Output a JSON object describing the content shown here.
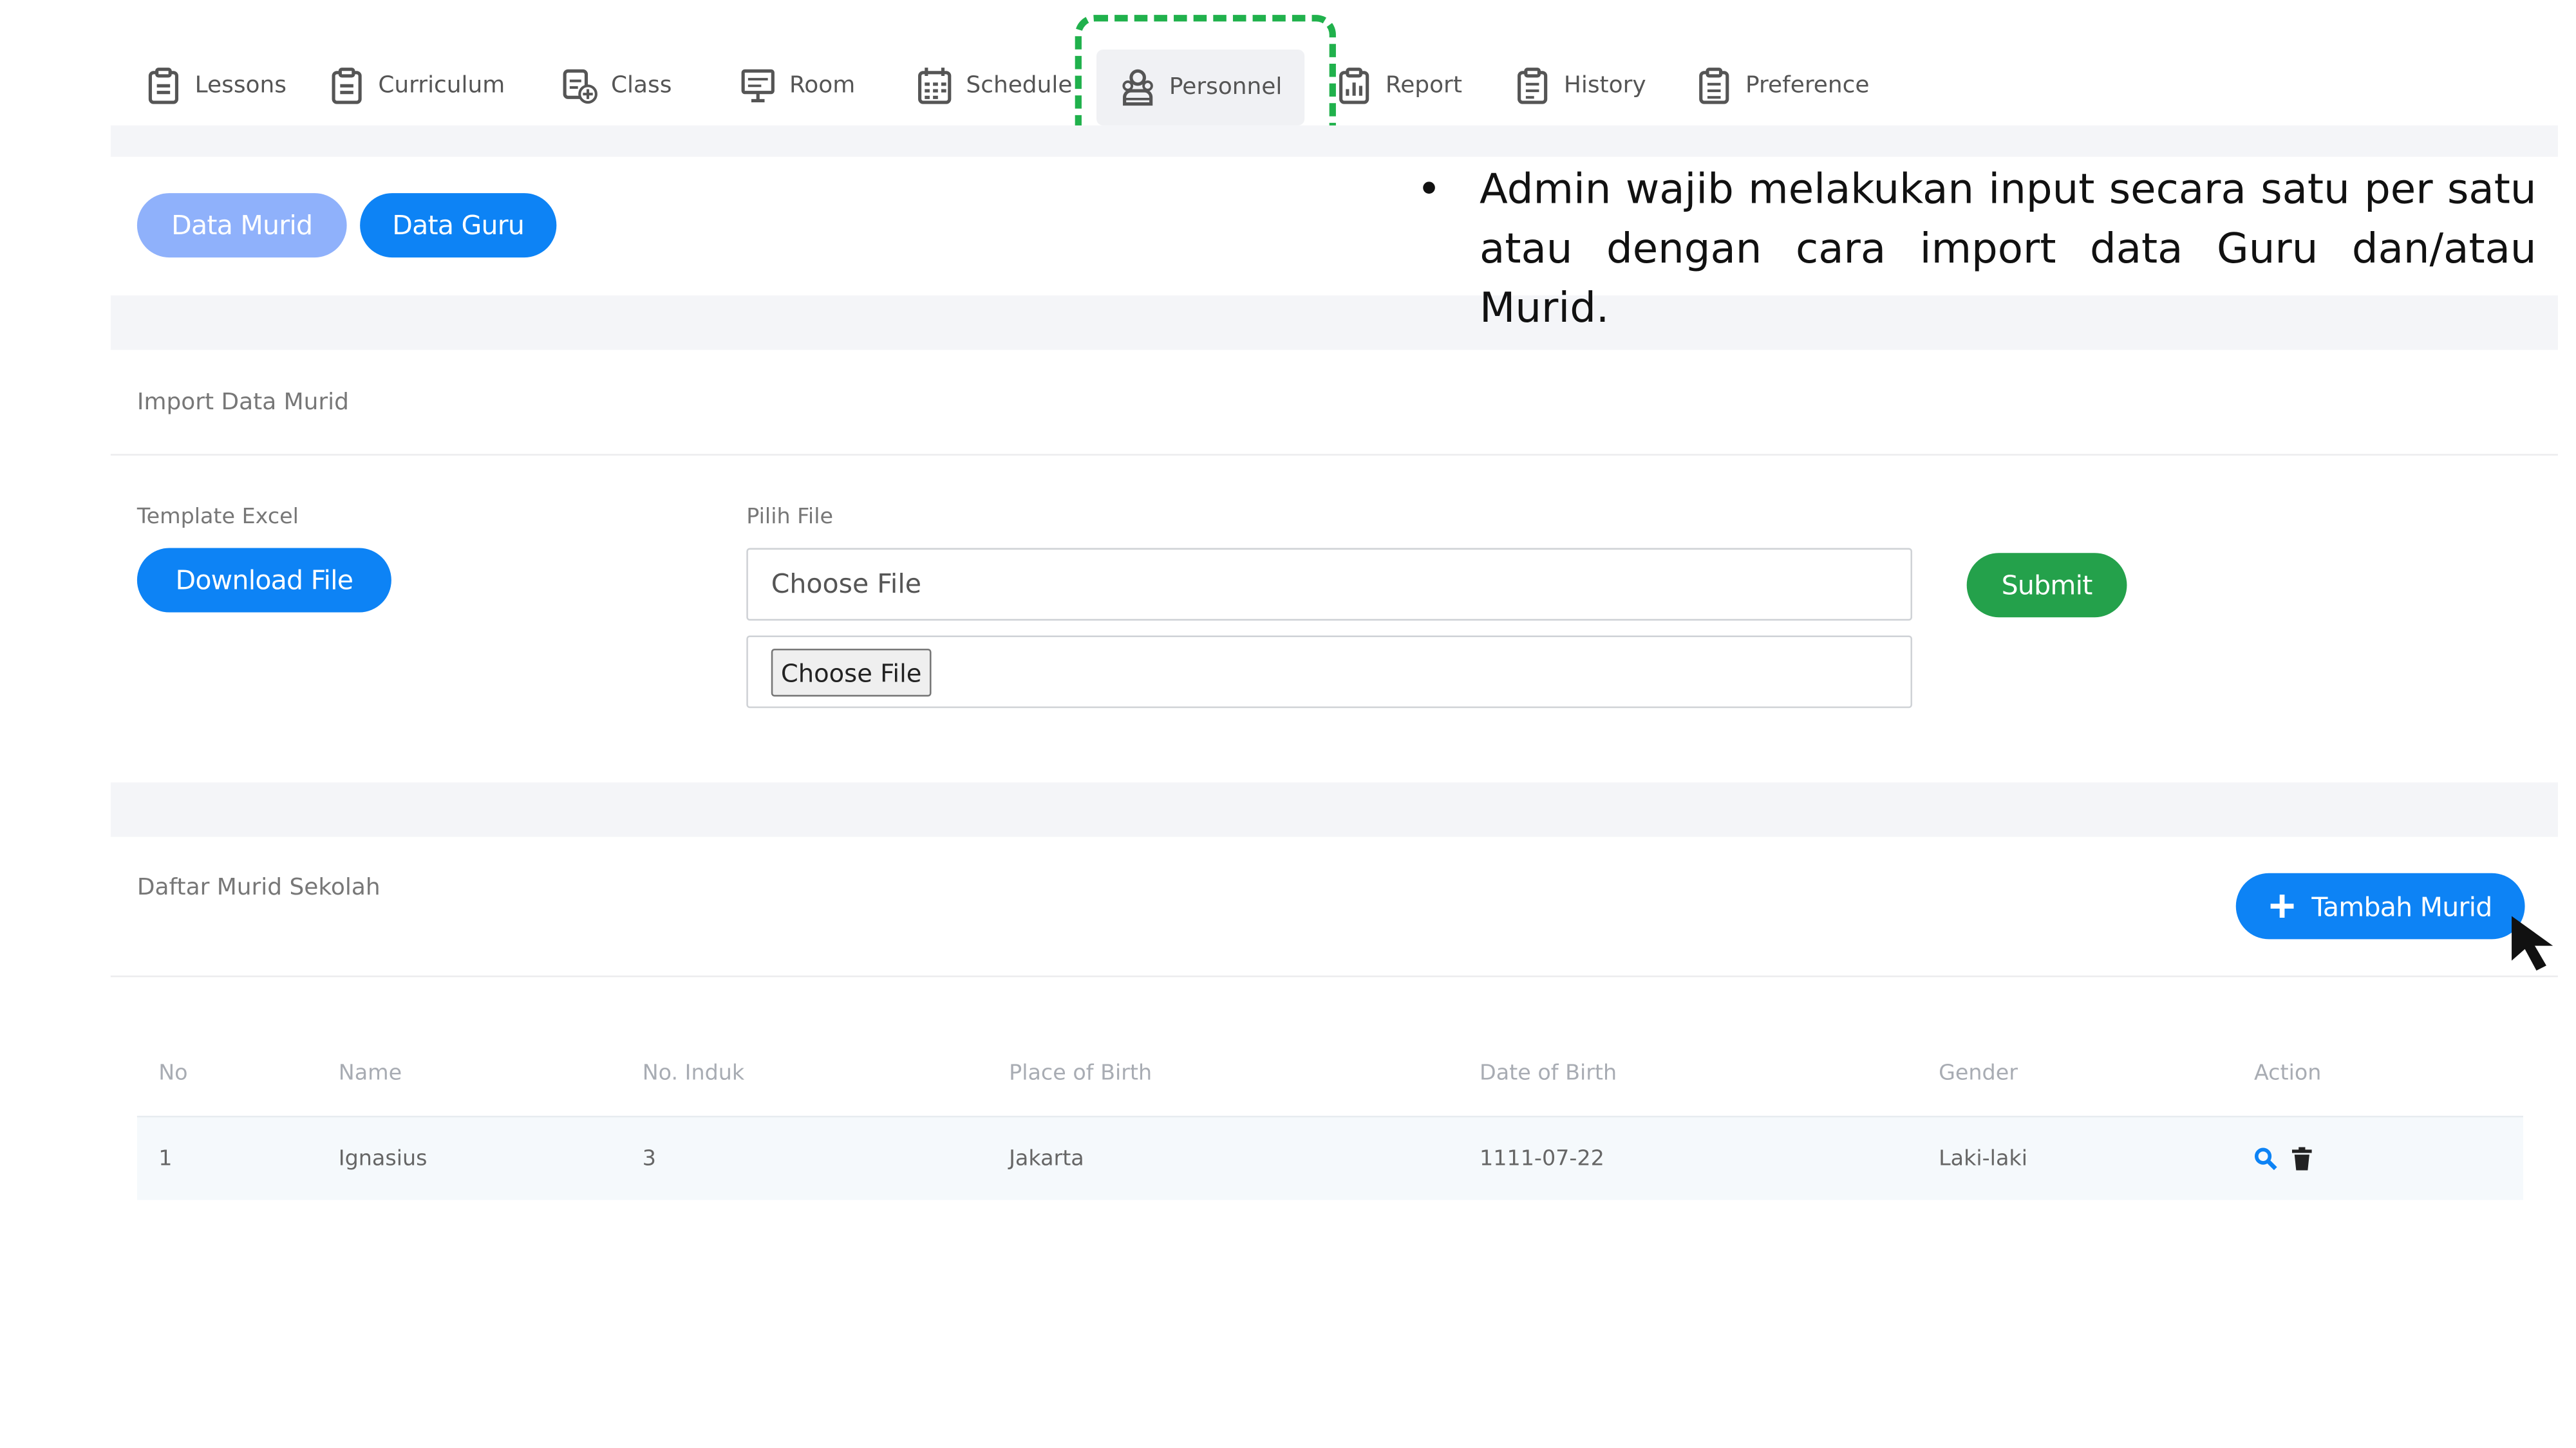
{
  "nav": {
    "items": [
      {
        "label": "Lessons",
        "icon": "clipboard-icon"
      },
      {
        "label": "Curriculum",
        "icon": "clipboard-icon"
      },
      {
        "label": "Class",
        "icon": "class-add-icon"
      },
      {
        "label": "Room",
        "icon": "presentation-icon"
      },
      {
        "label": "Schedule",
        "icon": "calendar-icon"
      },
      {
        "label": "Personnel",
        "icon": "people-icon",
        "active": true
      },
      {
        "label": "Report",
        "icon": "report-icon"
      },
      {
        "label": "History",
        "icon": "history-icon"
      },
      {
        "label": "Preference",
        "icon": "preference-icon"
      }
    ]
  },
  "tabs": {
    "murid": "Data Murid",
    "guru": "Data Guru"
  },
  "note": {
    "line1": "Admin wajib melakukan input secara satu per satu",
    "line2": "atau dengan cara import data Guru dan/atau Murid."
  },
  "import": {
    "title": "Import Data Murid",
    "template_label": "Template Excel",
    "download_button": "Download File",
    "file_label": "Pilih File",
    "file_placeholder": "Choose File",
    "file_button": "Choose File",
    "submit_button": "Submit"
  },
  "list": {
    "title": "Daftar Murid Sekolah",
    "add_button": "Tambah Murid",
    "columns": [
      "No",
      "Name",
      "No. Induk",
      "Place of Birth",
      "Date of Birth",
      "Gender",
      "Action"
    ],
    "rows": [
      {
        "no": "1",
        "name": "Ignasius",
        "induk": "3",
        "place": "Jakarta",
        "dob": "1111-07-22",
        "gender": "Laki-laki"
      }
    ]
  },
  "colors": {
    "primary": "#0d83f5",
    "primary_light": "#8fb1fb",
    "success": "#24a14b",
    "highlight": "#20b14c"
  }
}
